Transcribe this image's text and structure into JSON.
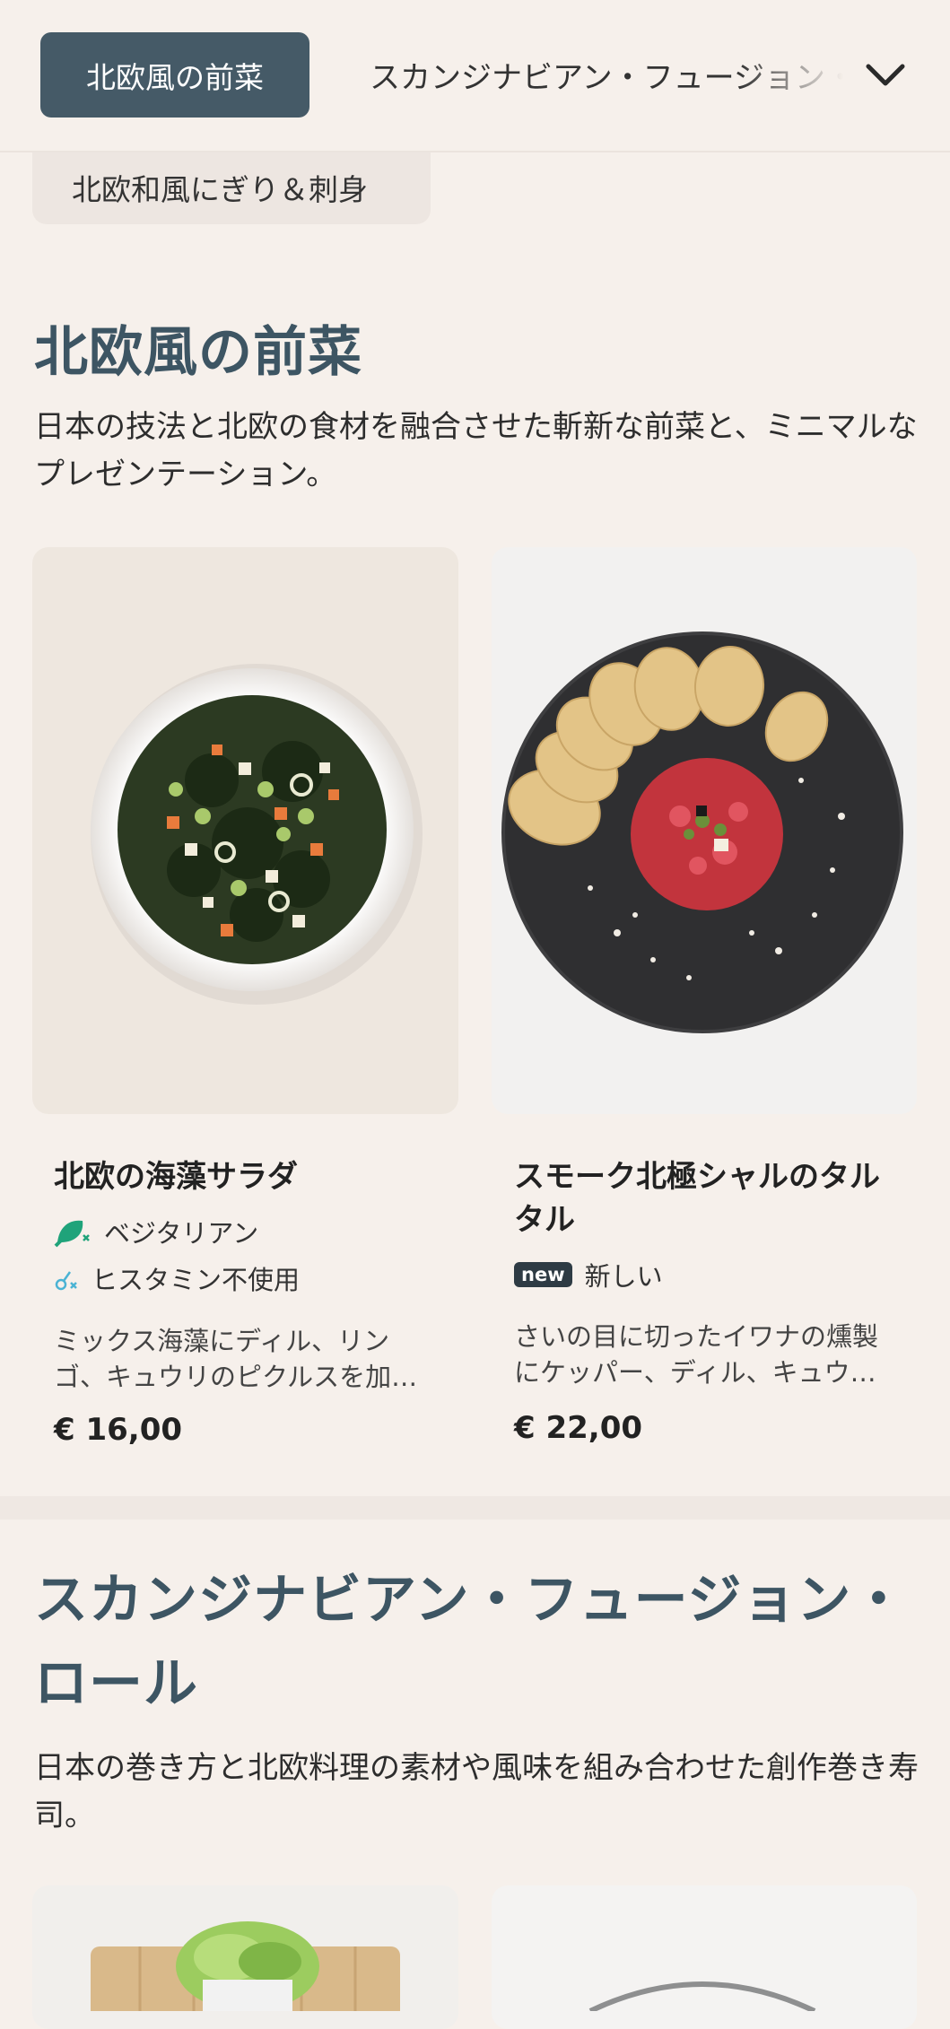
{
  "nav": {
    "active_tab": "北欧風の前菜",
    "next_tab": "スカンジナビアン・フュージョン・ロール",
    "prev_chip": "北欧和風にぎり＆刺身"
  },
  "section1": {
    "title": "北欧風の前菜",
    "description": "日本の技法と北欧の食材を融合させた斬新な前菜と、ミニマルなプレゼンテーション。",
    "items": [
      {
        "name": "北欧の海藻サラダ",
        "tags": [
          {
            "icon": "vegetarian-leaf-icon",
            "label": "ベジタリアン"
          },
          {
            "icon": "histamine-free-icon",
            "label": "ヒスタミン不使用"
          }
        ],
        "description": "ミックス海藻にディル、リンゴ、キュウリのピクルスを加…",
        "price": "€ 16,00"
      },
      {
        "name": "スモーク北極シャルのタルタル",
        "tags": [
          {
            "icon": "new-badge",
            "badge": "new",
            "label": "新しい"
          }
        ],
        "description": "さいの目に切ったイワナの燻製にケッパー、ディル、キュウ…",
        "price": "€ 22,00"
      }
    ]
  },
  "section2": {
    "title": "スカンジナビアン・フュージョン・ロール",
    "description": "日本の巻き方と北欧料理の素材や風味を組み合わせた創作巻き寿司。"
  },
  "colors": {
    "background": "#f6f0eb",
    "accent": "#455a67",
    "title": "#3d5563",
    "vegetarian": "#1fa37a",
    "histamine": "#4bb3d4"
  }
}
